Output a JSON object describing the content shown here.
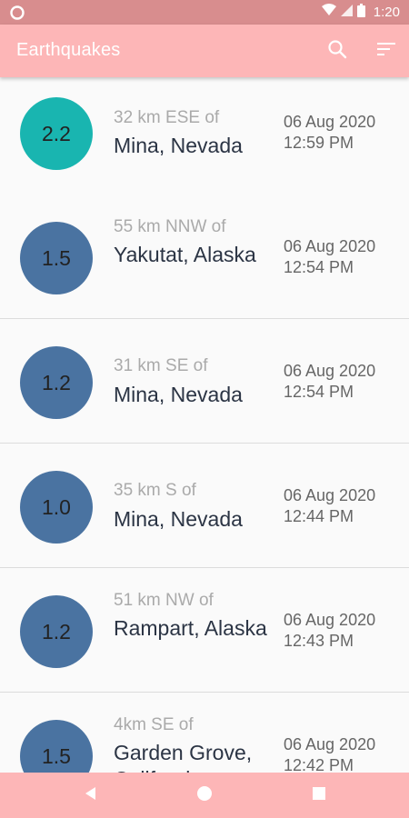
{
  "status_bar": {
    "time": "1:20"
  },
  "app_bar": {
    "title": "Earthquakes",
    "search_icon": "search-icon",
    "sort_icon": "sort-icon"
  },
  "colors": {
    "status_bar": "#d88d8e",
    "app_bar": "#fdb6b7",
    "mag_high": "#19b5b0",
    "mag_low": "#4a73a1"
  },
  "earthquakes": [
    {
      "magnitude": "2.2",
      "offset": "32 km ESE of",
      "place": "Mina, Nevada",
      "date": "06 Aug 2020",
      "time": "12:59 PM",
      "color": "#19b5b0"
    },
    {
      "magnitude": "1.5",
      "offset": "55 km NNW of",
      "place": "Yakutat, Alaska",
      "date": "06 Aug 2020",
      "time": "12:54 PM",
      "color": "#4a73a1"
    },
    {
      "magnitude": "1.2",
      "offset": "31 km SE of",
      "place": "Mina, Nevada",
      "date": "06 Aug 2020",
      "time": "12:54 PM",
      "color": "#4a73a1"
    },
    {
      "magnitude": "1.0",
      "offset": "35 km S of",
      "place": "Mina, Nevada",
      "date": "06 Aug 2020",
      "time": "12:44 PM",
      "color": "#4a73a1"
    },
    {
      "magnitude": "1.2",
      "offset": "51 km NW of",
      "place": "Rampart, Alaska",
      "date": "06 Aug 2020",
      "time": "12:43 PM",
      "color": "#4a73a1"
    },
    {
      "magnitude": "1.5",
      "offset": "4km SE of",
      "place": "Garden Grove, California",
      "date": "06 Aug 2020",
      "time": "12:42 PM",
      "color": "#4a73a1"
    }
  ],
  "nav_bar": {
    "back_icon": "back-icon",
    "home_icon": "home-icon",
    "recents_icon": "recents-icon"
  }
}
